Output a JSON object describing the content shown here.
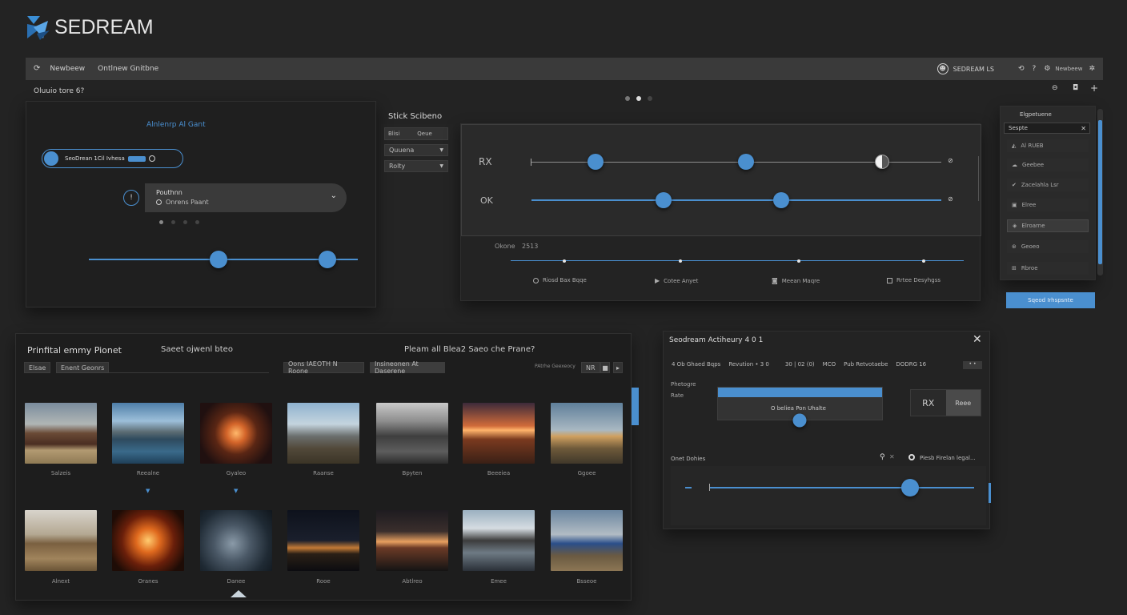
{
  "brand": {
    "name": "SEDREAM"
  },
  "topbar": {
    "nav_item": "Newbeew",
    "nav_item2": "Ontlnew Gnitbne",
    "user_label": "SEDREAM LS",
    "icons": [
      "refresh-icon",
      "user-icon",
      "gear-icon",
      "help-icon"
    ]
  },
  "page": {
    "subtitle": "Oluuio tore 6?",
    "toolbar_icons": [
      "link-icon",
      "camera-icon",
      "plus-icon"
    ]
  },
  "left_panel": {
    "title": "Alnlenrp Al Gant",
    "pill_label": "SeoDrean 1Cil Ivhesa",
    "dropdown_title": "Pouthnn",
    "dropdown_sub": "Onrens Paant"
  },
  "settings_panel": {
    "title": "Stick Scibeno",
    "tab1": "Blisi",
    "tab2": "Qeue",
    "select1": "Quuena",
    "select2": "Rolty"
  },
  "slider_panel": {
    "row1_label": "RX",
    "row2_label": "OK",
    "bottom_label": "Okone",
    "bottom_value": "2513",
    "legend": [
      "Riosd Bax Bqqe",
      "Cotee Anyet",
      "Meean Maqre",
      "Rrtee Desyhgss"
    ]
  },
  "right_list": {
    "header": "Elgpetuene",
    "search_value": "Sespte",
    "items": [
      "Al RUEB",
      "Geebee",
      "Zacelahla Lsr",
      "Elree",
      "Elroarne",
      "Geoeo",
      "Rbroe"
    ],
    "action_button": "Sqeod Irhspsnte"
  },
  "gallery": {
    "title": "Prinfital emmy Pionet",
    "subtitle": "Saeet ojwenl bteo",
    "center_title": "Pleam all Blea2 Saeo che Prane?",
    "filter1": "Elsae",
    "filter2": "Enent Geonrs",
    "chip1": "Oons IAEOTH N Roone",
    "chip2": "Insineonen At Daserene",
    "count_label": "PAtrhe Geexeocy",
    "count_value": "NR",
    "row1_captions": [
      "Salzeis",
      "Reealne",
      "Gyaleo",
      "Raanse",
      "Bpyten",
      "Beeeiea",
      "Ggoee"
    ],
    "row2_captions": [
      "Alnext",
      "Oranes",
      "Danee",
      "Rooe",
      "Abtlreo",
      "Emee",
      "Bsseoe"
    ]
  },
  "adjust_panel": {
    "title": "Seodream Actiheury 4 0 1",
    "row_a": "4 Ob Ghaed Bqps",
    "row_b": "Revution • 3 0",
    "row_c": "30 | 02 (0)",
    "row_d": "MCO",
    "row_e": "Pub Retvotaebe",
    "row_f": "DODRG 16",
    "side_label1": "Phetogre",
    "side_label2": "Rate",
    "preview_label": "O beliea Pon Uhalte",
    "toggle_left": "RX",
    "toggle_right": "Reee",
    "section_label": "Onet Dohies",
    "section_right": "Piesb Firelan legal..."
  }
}
